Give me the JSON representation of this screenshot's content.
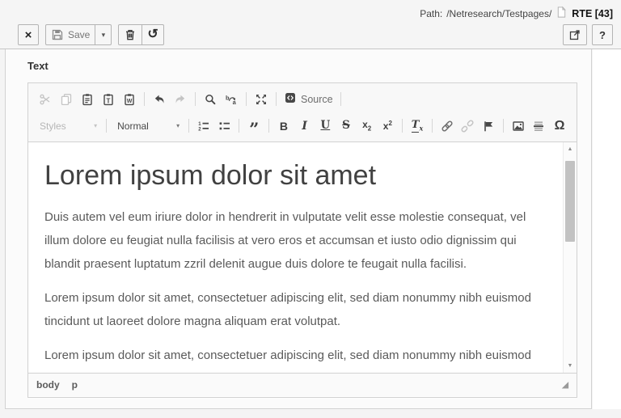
{
  "docheader": {
    "path_label": "Path:",
    "path_value": "/Netresearch/Testpages/",
    "record_title": "RTE [43]",
    "close_glyph": "×",
    "save_label": "Save",
    "caret_glyph": "▾",
    "history_glyph": "↺",
    "help_label": "?"
  },
  "form": {
    "field_label": "Text"
  },
  "editor": {
    "toolbar": {
      "source_label": "Source",
      "styles_label": "Styles",
      "format_label": "Normal",
      "combo_caret": "▾",
      "bold_glyph": "B",
      "italic_glyph": "I",
      "underline_glyph": "U",
      "strike_glyph": "S",
      "subscript_base": "x",
      "subscript_mark": "2",
      "superscript_base": "x",
      "superscript_mark": "2",
      "removeformat_base": "T",
      "removeformat_mark": "x",
      "blockquote_glyph": "”",
      "specialchar_glyph": "Ω"
    },
    "content": {
      "heading": "Lorem ipsum dolor sit amet",
      "paragraphs": [
        "Duis autem vel eum iriure dolor in hendrerit in vulputate velit esse molestie consequat, vel illum dolore eu feugiat nulla facilisis at vero eros et accumsan et iusto odio dignissim qui blandit praesent luptatum zzril delenit augue duis dolore te feugait nulla facilisi.",
        "Lorem ipsum dolor sit amet, consectetuer adipiscing elit, sed diam nonummy nibh euismod tincidunt ut laoreet dolore magna aliquam erat volutpat.",
        "Lorem ipsum dolor sit amet, consectetuer adipiscing elit, sed diam nonummy nibh euismod tincidunt ut laoreet dolore magna aliquam erat volutpat."
      ]
    },
    "elements_path": {
      "root": "body",
      "current": "p"
    },
    "scrollbar": {
      "up_glyph": "▲",
      "down_glyph": "▼",
      "resize_glyph": "◢"
    }
  },
  "colors": {
    "toolbar_bg": "#f8f8f8",
    "frame_border": "#d1d1d1",
    "icon": "#484848",
    "icon_disabled": "#c4c4c4",
    "header_bg": "#f5f5f5"
  }
}
